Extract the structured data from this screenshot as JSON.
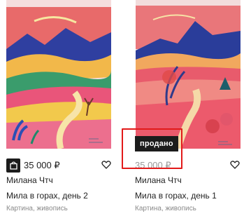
{
  "products": [
    {
      "author": "Милана Чтч",
      "title": "Мила в горах, день 2",
      "category": "Картина, живопись",
      "price": "35 000 ₽",
      "sold": false
    },
    {
      "author": "Милана Чтч",
      "title": "Мила в горах, день 1",
      "category": "Картина, живопись",
      "price": "35 000 ₽",
      "sold": true,
      "sold_label": "продано"
    }
  ],
  "icons": {
    "cart": "shopping-bag-icon",
    "favorite": "heart-icon"
  },
  "colors": {
    "highlight": "#e21a1a",
    "badge": "#1c1c1c",
    "sold_price": "#9a9a9a"
  }
}
